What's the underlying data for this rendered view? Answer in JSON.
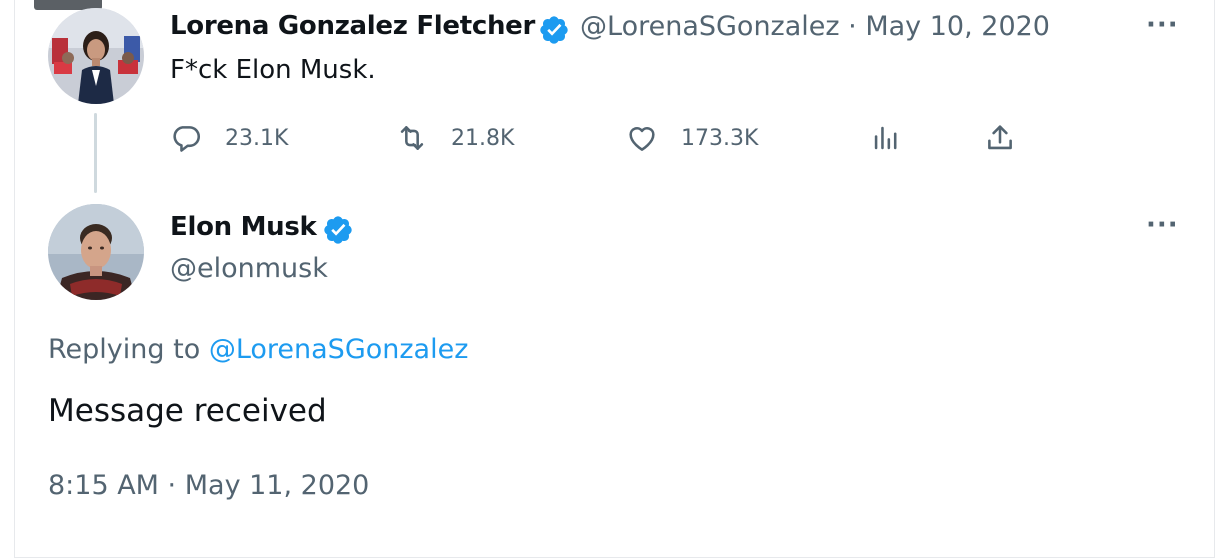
{
  "tweet_parent": {
    "author_name": "Lorena Gonzalez Fletcher",
    "handle": "@LorenaSGonzalez",
    "separator": "·",
    "date": "May 10, 2020",
    "text": "F*ck Elon Musk.",
    "stats": {
      "replies": "23.1K",
      "retweets": "21.8K",
      "likes": "173.3K"
    },
    "more_icon": "more-icon"
  },
  "tweet_reply": {
    "author_name": "Elon Musk",
    "handle": "@elonmusk",
    "replying_prefix": "Replying to ",
    "replying_handle": "@LorenaSGonzalez",
    "text": "Message received",
    "timestamp": "8:15 AM · May 11, 2020",
    "more_icon": "more-icon"
  },
  "colors": {
    "verified": "#1d9bf0",
    "link": "#1d9bf0",
    "muted": "#536471",
    "text": "#0f1419"
  },
  "icons": [
    "reply-icon",
    "retweet-icon",
    "like-icon",
    "views-icon",
    "share-icon",
    "verified-badge-icon"
  ]
}
